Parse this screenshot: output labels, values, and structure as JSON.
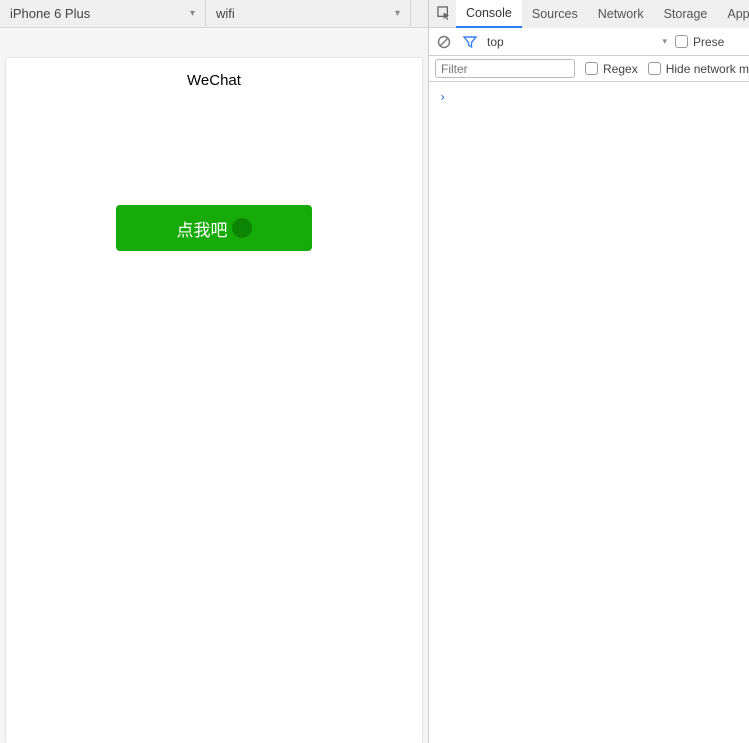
{
  "toolbar": {
    "device": "iPhone 6 Plus",
    "network": "wifi"
  },
  "preview": {
    "title": "WeChat",
    "button_label": "点我吧"
  },
  "devtools": {
    "tabs": [
      "Console",
      "Sources",
      "Network",
      "Storage",
      "AppD"
    ],
    "active_tab": "Console",
    "console": {
      "context": "top",
      "preserve_label": "Prese",
      "filter_placeholder": "Filter",
      "regex_label": "Regex",
      "hide_network_label": "Hide network me",
      "prompt": "›"
    }
  }
}
